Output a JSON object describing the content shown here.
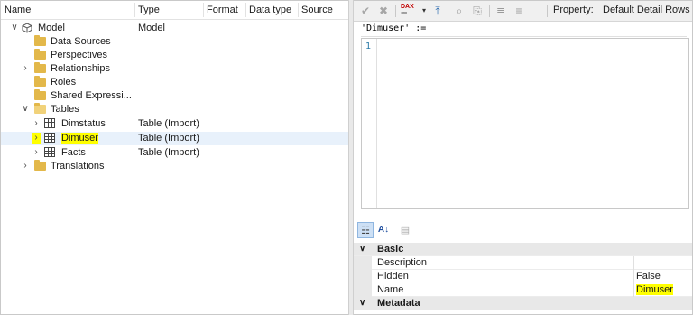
{
  "tree": {
    "columns": [
      "Name",
      "Type",
      "Format",
      "Data type",
      "Source"
    ],
    "rows": [
      {
        "label": "Model",
        "type": "Model"
      },
      {
        "label": "Data Sources",
        "type": ""
      },
      {
        "label": "Perspectives",
        "type": ""
      },
      {
        "label": "Relationships",
        "type": ""
      },
      {
        "label": "Roles",
        "type": ""
      },
      {
        "label": "Shared Expressi...",
        "type": ""
      },
      {
        "label": "Tables",
        "type": ""
      },
      {
        "label": "Dimstatus",
        "type": "Table (Import)"
      },
      {
        "label": "Dimuser",
        "type": "Table (Import)"
      },
      {
        "label": "Facts",
        "type": "Table (Import)"
      },
      {
        "label": "Translations",
        "type": ""
      }
    ]
  },
  "toolbar": {
    "dax_label": "DAX",
    "property_label": "Property:",
    "property_value": "Default Detail Rows"
  },
  "editor": {
    "formula": "'Dimuser' :=",
    "line_number": "1"
  },
  "properties": {
    "categories": [
      {
        "label": "Basic",
        "items": [
          {
            "name": "Description",
            "value": ""
          },
          {
            "name": "Hidden",
            "value": "False"
          },
          {
            "name": "Name",
            "value": "Dimuser"
          }
        ]
      },
      {
        "label": "Metadata",
        "items": []
      }
    ]
  },
  "colors": {
    "highlight": "#ffff00",
    "selection": "#e8f1fb",
    "folder": "#e3b84a"
  }
}
